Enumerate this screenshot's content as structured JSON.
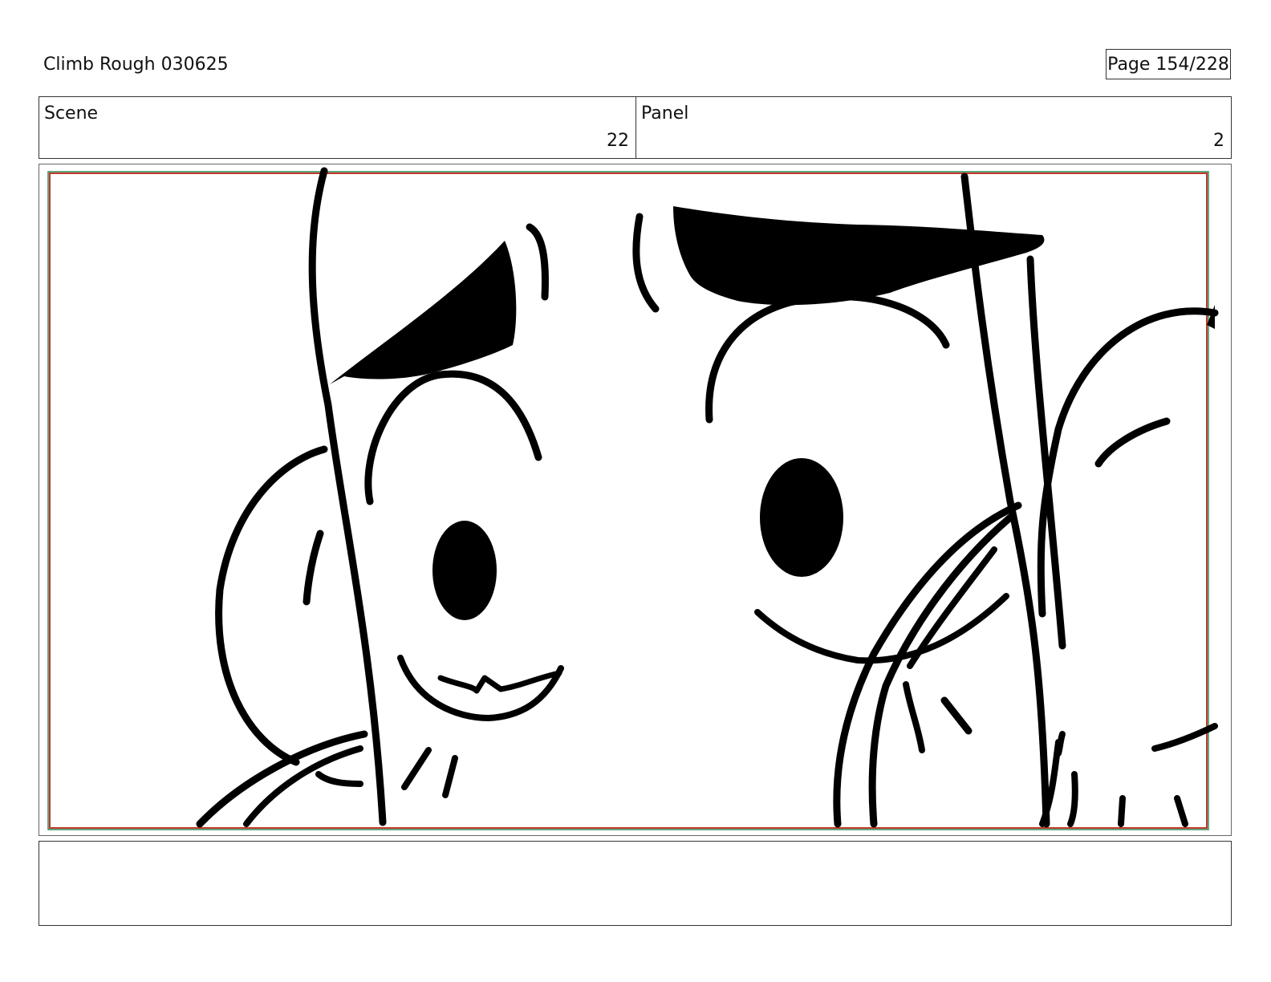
{
  "header": {
    "title": "Climb Rough 030625",
    "page": "Page 154/228"
  },
  "meta": {
    "scene_label": "Scene",
    "scene_value": "22",
    "panel_label": "Panel",
    "panel_value": "2"
  },
  "notes": {
    "text": ""
  },
  "colors": {
    "frame_red": "#c0392b",
    "frame_green": "#2e8b57",
    "ink": "#000000"
  }
}
